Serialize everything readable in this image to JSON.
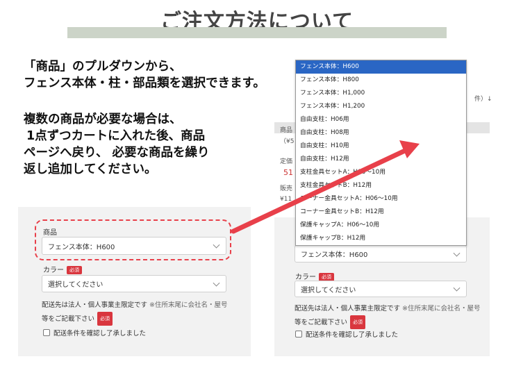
{
  "title": "ご注文方法について",
  "instructions": {
    "line1": "「商品」のプルダウンから、",
    "line2": "フェンス本体・柱・部品類を選択できます。",
    "para2": [
      "複数の商品が必要な場合は、",
      "1点ずつカートに入れた後、商品",
      "ページへ戻り、 必要な商品を繰り",
      "返し追加してください。"
    ]
  },
  "form": {
    "product_label": "商品",
    "product_value": "フェンス本体：H600",
    "color_label": "カラー",
    "required_badge": "必須",
    "color_value": "選択してください",
    "note_line1": "配送先は法人・個人事業主限定です",
    "note_line1_sub": "※住所末尾に会社名・屋号",
    "note_line2": "等をご記載下さい",
    "agree_label": "配送条件を確認し了承しました"
  },
  "background": {
    "frag_sort": "件）↓",
    "frag_product": "商品",
    "frag_paren": "（¥5",
    "frag_teika": "定価",
    "frag_price": "51",
    "frag_hanbai": "販売",
    "frag_yen": "¥11"
  },
  "dropdown_options": [
    "フェンス本体：H600",
    "フェンス本体：H800",
    "フェンス本体：H1,000",
    "フェンス本体：H1,200",
    "自由支柱：H06用",
    "自由支柱：H08用",
    "自由支柱：H10用",
    "自由支柱：H12用",
    "支柱金具セットA：H06～10用",
    "支柱金具セットB：H12用",
    "コーナー金具セットA：H06～10用",
    "コーナー金具セットB：H12用",
    "保護キャップA：H06～10用",
    "保護キャップB：H12用"
  ],
  "dropdown_selected_index": 0,
  "colors": {
    "accent_red": "#e8404a",
    "select_blue": "#2a66c4",
    "title_bar": "#ccd4c8"
  }
}
